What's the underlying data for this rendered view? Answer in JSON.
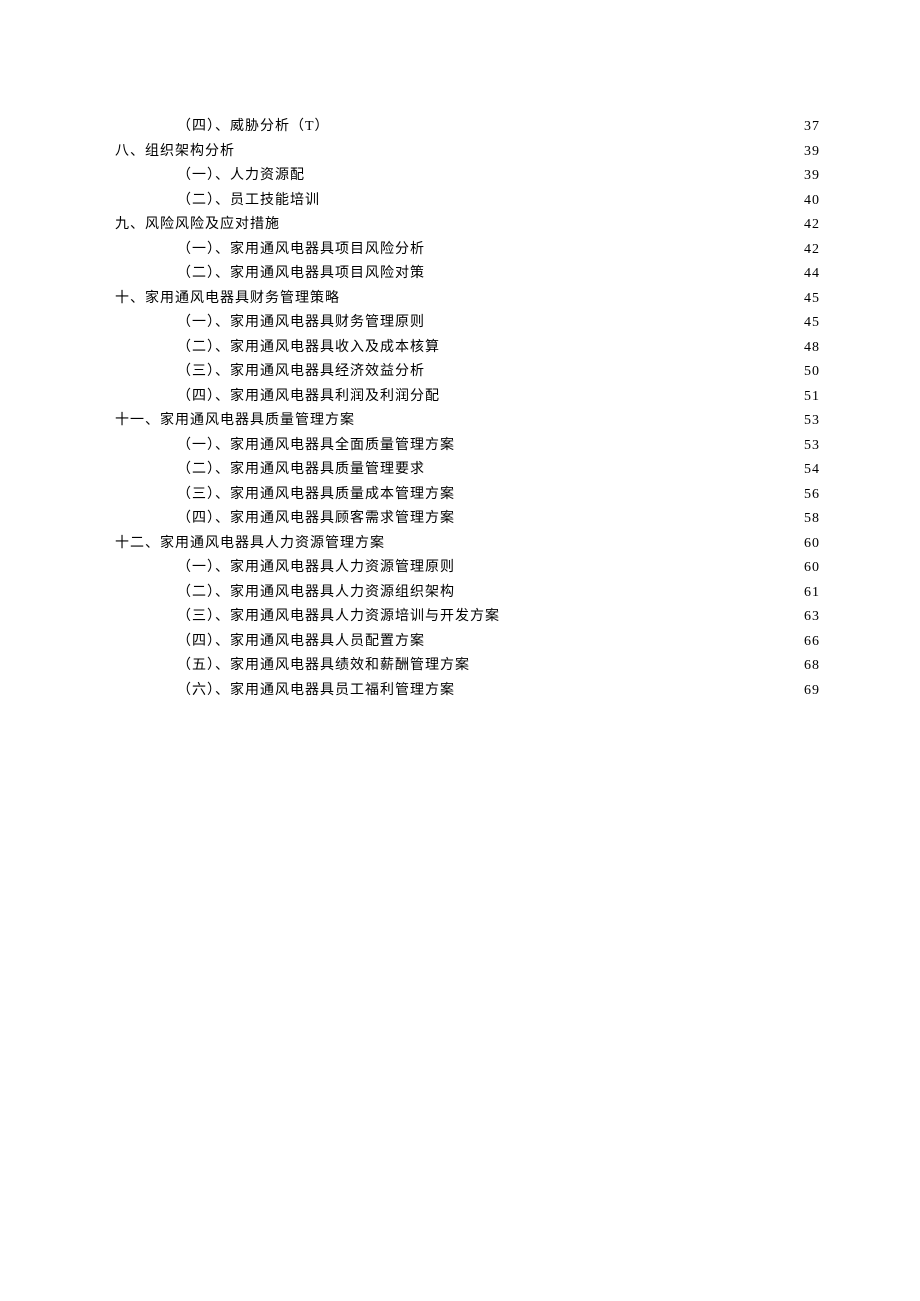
{
  "toc": [
    {
      "level": 2,
      "label": "（四）、威胁分析（T）",
      "page": "37"
    },
    {
      "level": 1,
      "label": "八、组织架构分析",
      "page": "39"
    },
    {
      "level": 2,
      "label": "（一）、人力资源配",
      "page": "39"
    },
    {
      "level": 2,
      "label": "（二）、员工技能培训",
      "page": "40"
    },
    {
      "level": 1,
      "label": "九、风险风险及应对措施",
      "page": "42"
    },
    {
      "level": 2,
      "label": "（一）、家用通风电器具项目风险分析",
      "page": "42"
    },
    {
      "level": 2,
      "label": "（二）、家用通风电器具项目风险对策",
      "page": "44"
    },
    {
      "level": 1,
      "label": "十、家用通风电器具财务管理策略",
      "page": "45"
    },
    {
      "level": 2,
      "label": "（一）、家用通风电器具财务管理原则",
      "page": "45"
    },
    {
      "level": 2,
      "label": "（二）、家用通风电器具收入及成本核算",
      "page": "48"
    },
    {
      "level": 2,
      "label": "（三）、家用通风电器具经济效益分析",
      "page": "50"
    },
    {
      "level": 2,
      "label": "（四）、家用通风电器具利润及利润分配",
      "page": "51"
    },
    {
      "level": 1,
      "label": "十一、家用通风电器具质量管理方案",
      "page": "53"
    },
    {
      "level": 2,
      "label": "（一）、家用通风电器具全面质量管理方案",
      "page": "53"
    },
    {
      "level": 2,
      "label": "（二）、家用通风电器具质量管理要求",
      "page": "54"
    },
    {
      "level": 2,
      "label": "（三）、家用通风电器具质量成本管理方案",
      "page": "56"
    },
    {
      "level": 2,
      "label": "（四）、家用通风电器具顾客需求管理方案",
      "page": "58"
    },
    {
      "level": 1,
      "label": "十二、家用通风电器具人力资源管理方案",
      "page": "60"
    },
    {
      "level": 2,
      "label": "（一）、家用通风电器具人力资源管理原则",
      "page": "60"
    },
    {
      "level": 2,
      "label": "（二）、家用通风电器具人力资源组织架构",
      "page": "61"
    },
    {
      "level": 2,
      "label": "（三）、家用通风电器具人力资源培训与开发方案",
      "page": "63"
    },
    {
      "level": 2,
      "label": "（四）、家用通风电器具人员配置方案",
      "page": "66"
    },
    {
      "level": 2,
      "label": "（五）、家用通风电器具绩效和薪酬管理方案",
      "page": "68"
    },
    {
      "level": 2,
      "label": "（六）、家用通风电器具员工福利管理方案",
      "page": "69"
    }
  ]
}
